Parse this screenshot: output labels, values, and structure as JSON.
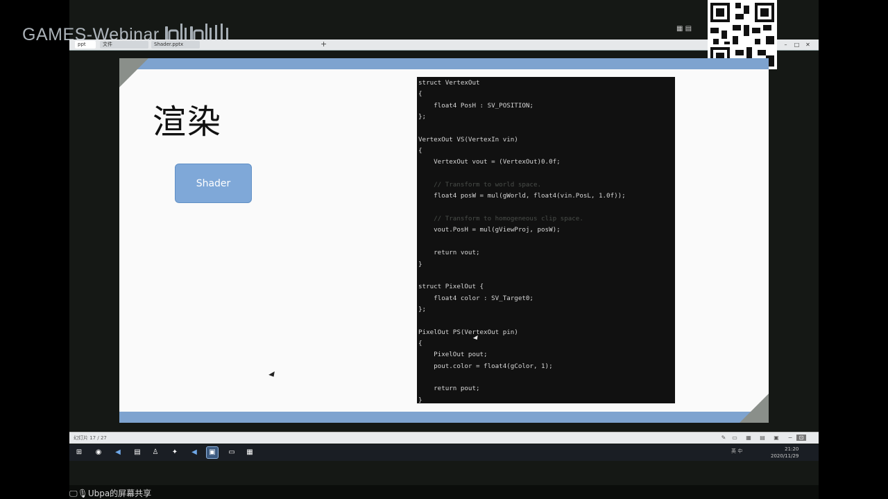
{
  "overlay": {
    "brand": "GAMES-Webinar",
    "brand_logo": "bilibili",
    "share_label": "Ubpa的屏幕共享"
  },
  "browser": {
    "tabs": [
      {
        "label": "ppt",
        "active": true
      },
      {
        "label": "文件",
        "active": false
      },
      {
        "label": "Shader.pptx",
        "active": false
      }
    ],
    "new_tab": "+"
  },
  "slide": {
    "title": "渲染",
    "shader_button": "Shader",
    "code_lines": [
      {
        "t": "struct VertexOut",
        "c": false
      },
      {
        "t": "{",
        "c": false
      },
      {
        "t": "    float4 PosH : SV_POSITION;",
        "c": false
      },
      {
        "t": "};",
        "c": false
      },
      {
        "t": "",
        "c": false
      },
      {
        "t": "VertexOut VS(VertexIn vin)",
        "c": false
      },
      {
        "t": "{",
        "c": false
      },
      {
        "t": "    VertexOut vout = (VertexOut)0.0f;",
        "c": false
      },
      {
        "t": "",
        "c": false
      },
      {
        "t": "    // Transform to world space.",
        "c": true
      },
      {
        "t": "    float4 posW = mul(gWorld, float4(vin.PosL, 1.0f));",
        "c": false
      },
      {
        "t": "",
        "c": false
      },
      {
        "t": "    // Transform to homogeneous clip space.",
        "c": true
      },
      {
        "t": "    vout.PosH = mul(gViewProj, posW);",
        "c": false
      },
      {
        "t": "",
        "c": false
      },
      {
        "t": "    return vout;",
        "c": false
      },
      {
        "t": "}",
        "c": false
      },
      {
        "t": "",
        "c": false
      },
      {
        "t": "struct PixelOut {",
        "c": false
      },
      {
        "t": "    float4 color : SV_Target0;",
        "c": false
      },
      {
        "t": "};",
        "c": false
      },
      {
        "t": "",
        "c": false
      },
      {
        "t": "PixelOut PS(VertexOut pin)",
        "c": false
      },
      {
        "t": "{",
        "c": false
      },
      {
        "t": "    PixelOut pout;",
        "c": false
      },
      {
        "t": "    pout.color = float4(gColor, 1);",
        "c": false
      },
      {
        "t": "",
        "c": false
      },
      {
        "t": "    return pout;",
        "c": false
      },
      {
        "t": "}",
        "c": false
      }
    ]
  },
  "statusbar": {
    "page": "幻灯片 17 / 27"
  },
  "taskbar": {
    "time": "21:20",
    "date": "2020/11/29",
    "tray": "英 中"
  },
  "colors": {
    "slide_band": "#7ea3cf",
    "shader_button": "#7fa8d8",
    "code_bg": "#111111"
  },
  "icons": [
    "windows-start-icon",
    "search-icon",
    "vscode-icon",
    "explorer-icon",
    "close-icon",
    "minimize-icon",
    "maximize-icon",
    "qr-code-icon",
    "university-seal-icon",
    "mouse-cursor-icon"
  ]
}
